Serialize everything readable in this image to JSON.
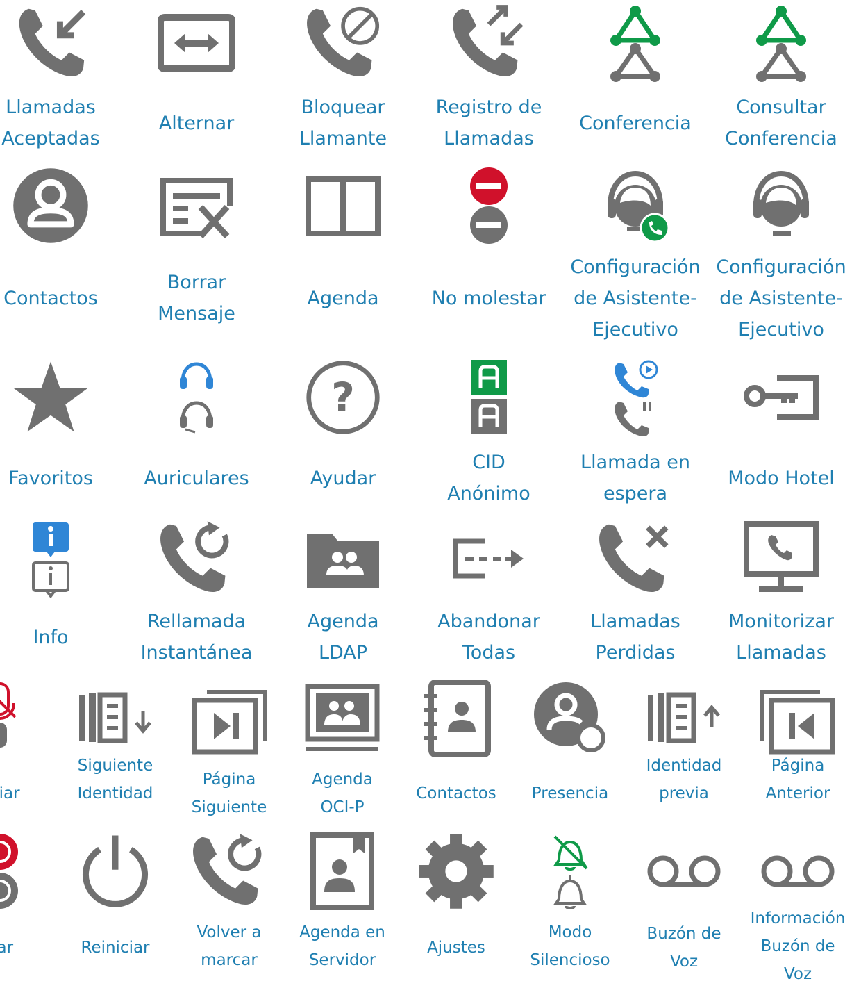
{
  "rows": [
    {
      "items": [
        {
          "label": "Llamadas Aceptadas",
          "icon": "call-accepted-icon"
        },
        {
          "label": "Alternar",
          "icon": "swap-icon"
        },
        {
          "label": "Bloquear Llamante",
          "icon": "block-caller-icon"
        },
        {
          "label": "Registro de Llamadas",
          "icon": "call-log-icon"
        },
        {
          "label": "Conferencia",
          "icon": "conference-icon"
        },
        {
          "label": "Consultar Conferencia",
          "icon": "consult-conference-icon"
        }
      ]
    },
    {
      "items": [
        {
          "label": "Contactos",
          "icon": "contacts-icon"
        },
        {
          "label": "Borrar Mensaje",
          "icon": "delete-message-icon"
        },
        {
          "label": "Agenda",
          "icon": "directory-book-icon"
        },
        {
          "label": "No molestar",
          "icon": "do-not-disturb-icon"
        },
        {
          "label": "Configuración de Asistente-Ejecutivo",
          "icon": "assistant-active-icon"
        },
        {
          "label": "Configuración de Asistente-Ejecutivo",
          "icon": "assistant-icon"
        }
      ]
    },
    {
      "items": [
        {
          "label": "Favoritos",
          "icon": "star-icon"
        },
        {
          "label": "Auriculares",
          "icon": "headset-icon"
        },
        {
          "label": "Ayudar",
          "icon": "help-icon"
        },
        {
          "label": "CID Anónimo",
          "icon": "anonymous-cid-icon"
        },
        {
          "label": "Llamada en espera",
          "icon": "call-on-hold-icon"
        },
        {
          "label": "Modo Hotel",
          "icon": "hotel-key-icon"
        }
      ]
    },
    {
      "items": [
        {
          "label": "Info",
          "icon": "info-icon"
        },
        {
          "label": "Rellamada Instantánea",
          "icon": "instant-redial-icon"
        },
        {
          "label": "Agenda LDAP",
          "icon": "ldap-folder-icon"
        },
        {
          "label": "Abandonar Todas",
          "icon": "leave-all-icon"
        },
        {
          "label": "Llamadas Perdidas",
          "icon": "missed-call-icon"
        },
        {
          "label": "Monitorizar Llamadas",
          "icon": "monitor-call-icon"
        }
      ]
    },
    {
      "items": [
        {
          "label": "nciar",
          "icon": "mute-mic-icon"
        },
        {
          "label": "Siguiente Identidad",
          "icon": "next-identity-icon"
        },
        {
          "label": "Página Siguiente",
          "icon": "next-page-icon"
        },
        {
          "label": "Agenda OCI-P",
          "icon": "oci-directory-icon"
        },
        {
          "label": "Contactos",
          "icon": "address-book-icon"
        },
        {
          "label": "Presencia",
          "icon": "presence-icon"
        },
        {
          "label": "Identidad previa",
          "icon": "previous-identity-icon"
        },
        {
          "label": "Página Anterior",
          "icon": "previous-page-icon"
        }
      ]
    },
    {
      "items": [
        {
          "label": "bar",
          "icon": "record-icon"
        },
        {
          "label": "Reiniciar",
          "icon": "power-icon"
        },
        {
          "label": "Volver a marcar",
          "icon": "redial-icon"
        },
        {
          "label": "Agenda en Servidor",
          "icon": "server-directory-icon"
        },
        {
          "label": "Ajustes",
          "icon": "gear-icon"
        },
        {
          "label": "Modo Silencioso",
          "icon": "silent-bell-icon"
        },
        {
          "label": "Buzón de Voz",
          "icon": "voicemail-icon"
        },
        {
          "label": "Información Buzón de Voz",
          "icon": "voicemail-info-icon"
        }
      ]
    }
  ],
  "colors": {
    "icon_gray": "#707070",
    "label_blue": "#1f7fb1",
    "accent_green": "#0f9a48",
    "alert_red": "#d0112b",
    "headset_blue": "#2f86d6"
  }
}
